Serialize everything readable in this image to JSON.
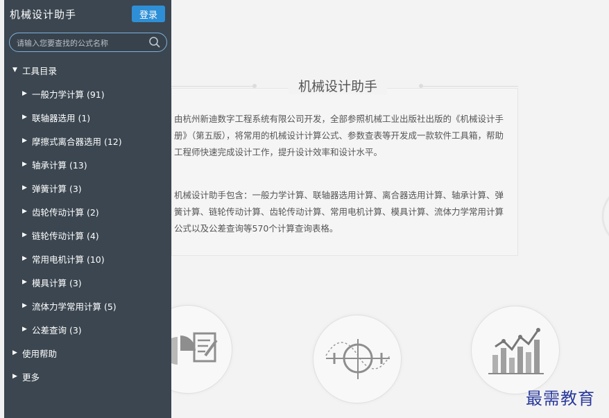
{
  "app": {
    "title": "机械设计助手",
    "login_label": "登录"
  },
  "search": {
    "placeholder": "请输入您要查找的公式名称"
  },
  "tree": {
    "root": {
      "label": "工具目录",
      "expanded": true
    },
    "children": [
      {
        "label": "一般力学计算 (91)"
      },
      {
        "label": "联轴器选用 (1)"
      },
      {
        "label": "摩擦式离合器选用 (12)"
      },
      {
        "label": "轴承计算 (13)"
      },
      {
        "label": "弹簧计算 (3)"
      },
      {
        "label": "齿轮传动计算 (2)"
      },
      {
        "label": "链轮传动计算 (4)"
      },
      {
        "label": "常用电机计算 (10)"
      },
      {
        "label": "模具计算 (3)"
      },
      {
        "label": "流体力学常用计算 (5)"
      },
      {
        "label": "公差查询 (3)"
      }
    ],
    "others": [
      {
        "label": "使用帮助"
      },
      {
        "label": "更多"
      }
    ]
  },
  "main": {
    "title": "机械设计助手",
    "para1": "由杭州新迪数字工程系统有限公司开发，全部参照机械工业出版社出版的《机械设计手册》（第五版），将常用的机械设计计算公式、参数查表等开发成一款软件工具箱，帮助工程师快速完成设计工作，提升设计效率和设计水平。",
    "para2": "机械设计助手包含：一般力学计算、联轴器选用计算、离合器选用计算、轴承计算、弹簧计算、链轮传动计算、齿轮传动计算、常用电机计算、模具计算、流体力学常用计算公式以及公差查询等570个计算查询表格。"
  },
  "watermark": "最需教育",
  "colors": {
    "sidebar": "#3b4650",
    "accent": "#2e8fd6",
    "watermark": "#2a3a9c"
  },
  "icons": [
    "search-icon",
    "chart-edit-icon",
    "crosshair-curve-icon",
    "bar-trend-icon"
  ]
}
